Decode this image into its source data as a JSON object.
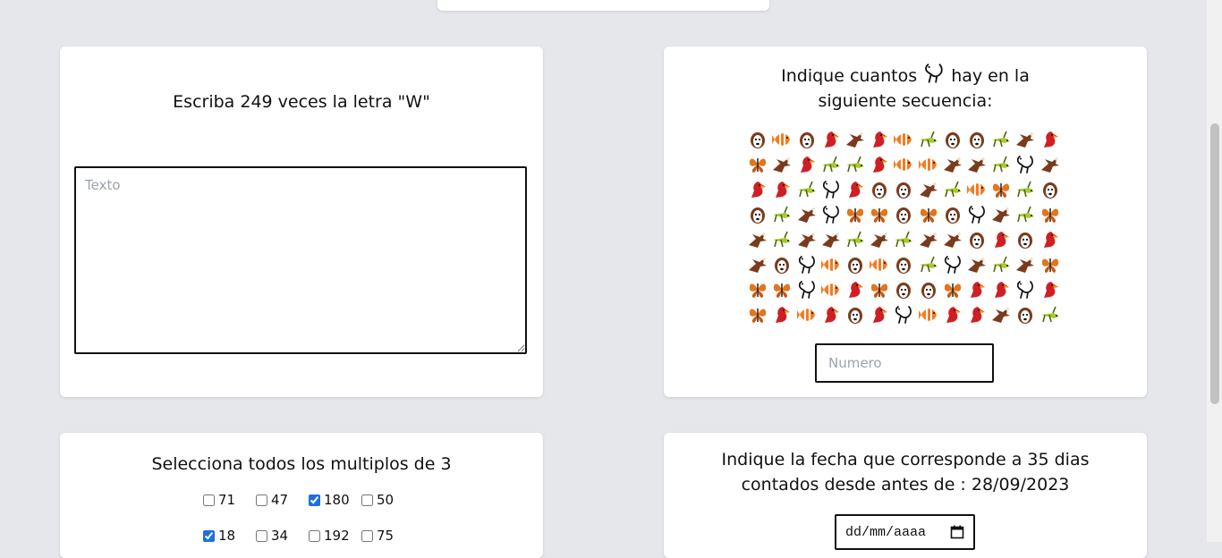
{
  "card_write": {
    "instruction": "Escriba 249 veces la letra \"W\"",
    "placeholder": "Texto",
    "value": ""
  },
  "card_count": {
    "instruction_before": "Indique cuantos",
    "instruction_icon": "rooster-icon",
    "instruction_after": "hay en la siguiente secuencia:",
    "sequence": [
      [
        "dog",
        "fish",
        "dog",
        "cardinal",
        "eagle",
        "cardinal",
        "fish",
        "grasshopper",
        "dog",
        "dog",
        "grasshopper",
        "eagle",
        "cardinal"
      ],
      [
        "butterfly",
        "eagle",
        "cardinal",
        "grasshopper",
        "grasshopper",
        "cardinal",
        "fish",
        "fish",
        "eagle",
        "eagle",
        "grasshopper",
        "rooster",
        "eagle"
      ],
      [
        "cardinal",
        "cardinal",
        "grasshopper",
        "rooster",
        "cardinal",
        "dog",
        "dog",
        "eagle",
        "grasshopper",
        "fish",
        "butterfly",
        "grasshopper",
        "dog"
      ],
      [
        "dog",
        "grasshopper",
        "eagle",
        "rooster",
        "butterfly",
        "butterfly",
        "dog",
        "butterfly",
        "dog",
        "rooster",
        "eagle",
        "grasshopper",
        "butterfly"
      ],
      [
        "eagle",
        "grasshopper",
        "eagle",
        "eagle",
        "grasshopper",
        "eagle",
        "grasshopper",
        "eagle",
        "eagle",
        "dog",
        "cardinal",
        "dog",
        "cardinal"
      ],
      [
        "eagle",
        "dog",
        "rooster",
        "fish",
        "dog",
        "fish",
        "dog",
        "grasshopper",
        "rooster",
        "eagle",
        "grasshopper",
        "eagle",
        "butterfly"
      ],
      [
        "butterfly",
        "butterfly",
        "rooster",
        "fish",
        "cardinal",
        "butterfly",
        "dog",
        "dog",
        "butterfly",
        "cardinal",
        "cardinal",
        "rooster",
        "cardinal"
      ],
      [
        "butterfly",
        "cardinal",
        "fish",
        "cardinal",
        "dog",
        "cardinal",
        "rooster",
        "fish",
        "cardinal",
        "cardinal",
        "eagle",
        "dog",
        "grasshopper"
      ]
    ],
    "placeholder": "Numero",
    "value": ""
  },
  "card_multiples": {
    "instruction": "Selecciona todos los multiplos de 3",
    "options": [
      {
        "label": "71",
        "checked": false
      },
      {
        "label": "47",
        "checked": false
      },
      {
        "label": "180",
        "checked": true
      },
      {
        "label": "50",
        "checked": false
      },
      {
        "label": "18",
        "checked": true
      },
      {
        "label": "34",
        "checked": false
      },
      {
        "label": "192",
        "checked": false
      },
      {
        "label": "75",
        "checked": false
      }
    ]
  },
  "card_date": {
    "instruction": "Indique la fecha que corresponde a 35 dias contados desde antes de : 28/09/2023",
    "placeholder": "dd/mm/aaaa",
    "icon": "calendar-icon"
  },
  "colors": {
    "background": "#e5e7eb",
    "card": "#ffffff",
    "checkbox_accent": "#1d6fe0"
  }
}
